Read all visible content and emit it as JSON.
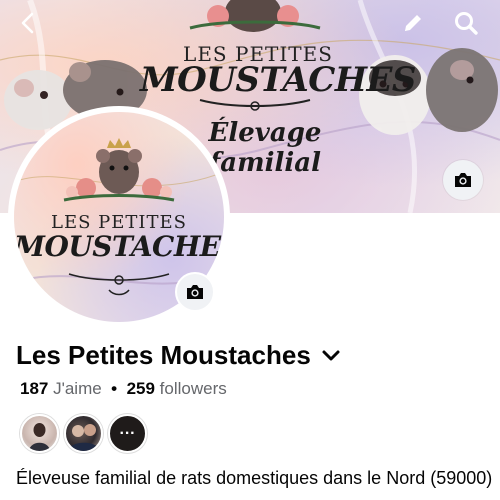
{
  "cover": {
    "logo_line1": "LES PETITES",
    "logo_line2": "MOUSTACHES",
    "logo_line3": "Élevage familial"
  },
  "avatar": {
    "logo_line1": "LES PETITES",
    "logo_line2": "MOUSTACHES"
  },
  "page": {
    "name": "Les Petites Moustaches",
    "likes_count": "187",
    "likes_label": "J'aime",
    "separator": "•",
    "followers_count": "259",
    "followers_label": "followers",
    "more_friends": "···",
    "bio": "Éleveuse familial de rats domestiques dans le Nord (59000)"
  },
  "icons": {
    "back": "back-arrow-icon",
    "edit": "pencil-icon",
    "search": "search-icon",
    "camera": "camera-icon",
    "dropdown": "chevron-down-icon"
  }
}
